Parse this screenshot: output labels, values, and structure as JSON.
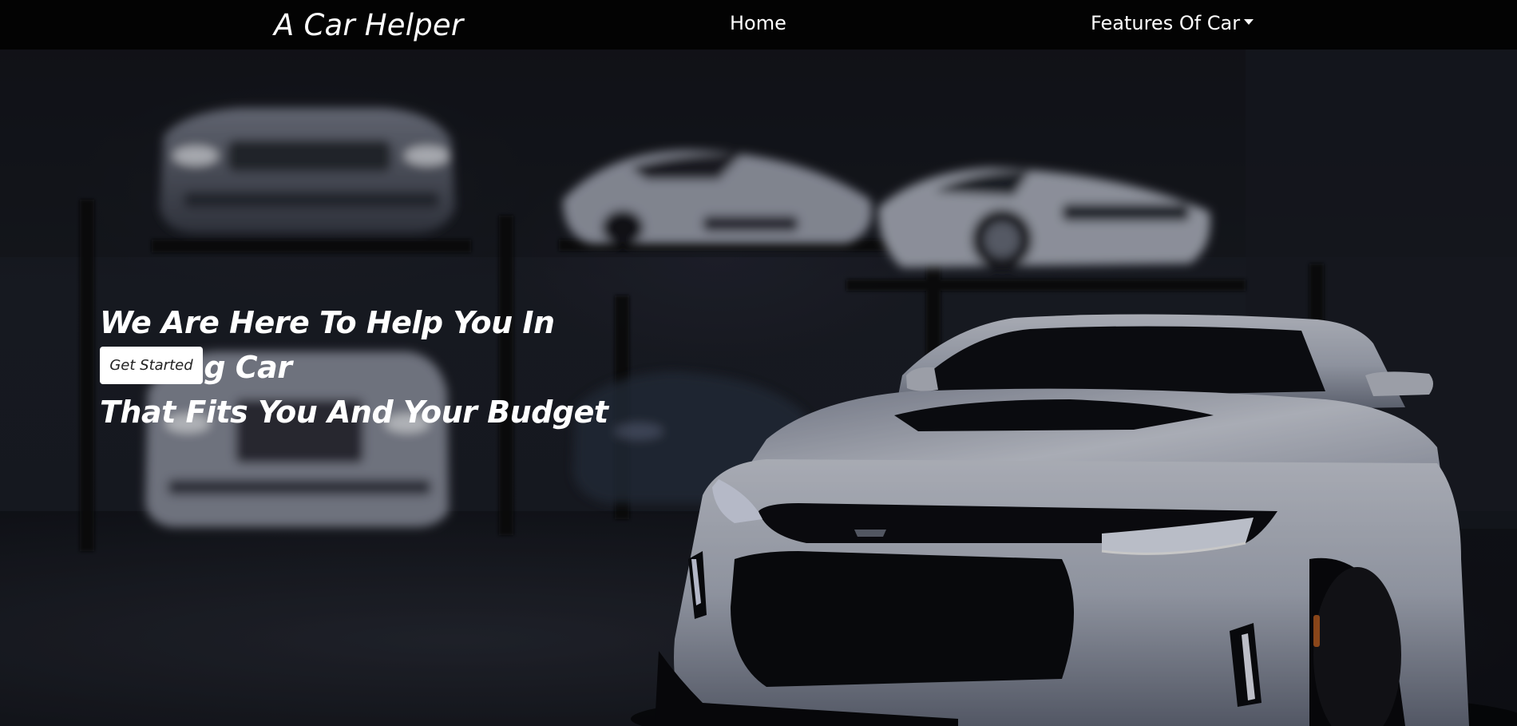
{
  "navbar": {
    "brand": "A Car Helper",
    "home_label": "Home",
    "features_label": "Features Of Car"
  },
  "hero": {
    "headline_line1": "We Are Here To Help You In Finding Car",
    "headline_line2": "That Fits You And Your Budget",
    "cta_label": "Get Started"
  },
  "icons": {
    "dropdown": "caret-down-icon"
  },
  "colors": {
    "navbar_bg": "#030303",
    "text": "#ffffff",
    "button_bg": "#ffffff",
    "button_text": "#222222",
    "hero_bg": "#1c1f28"
  }
}
